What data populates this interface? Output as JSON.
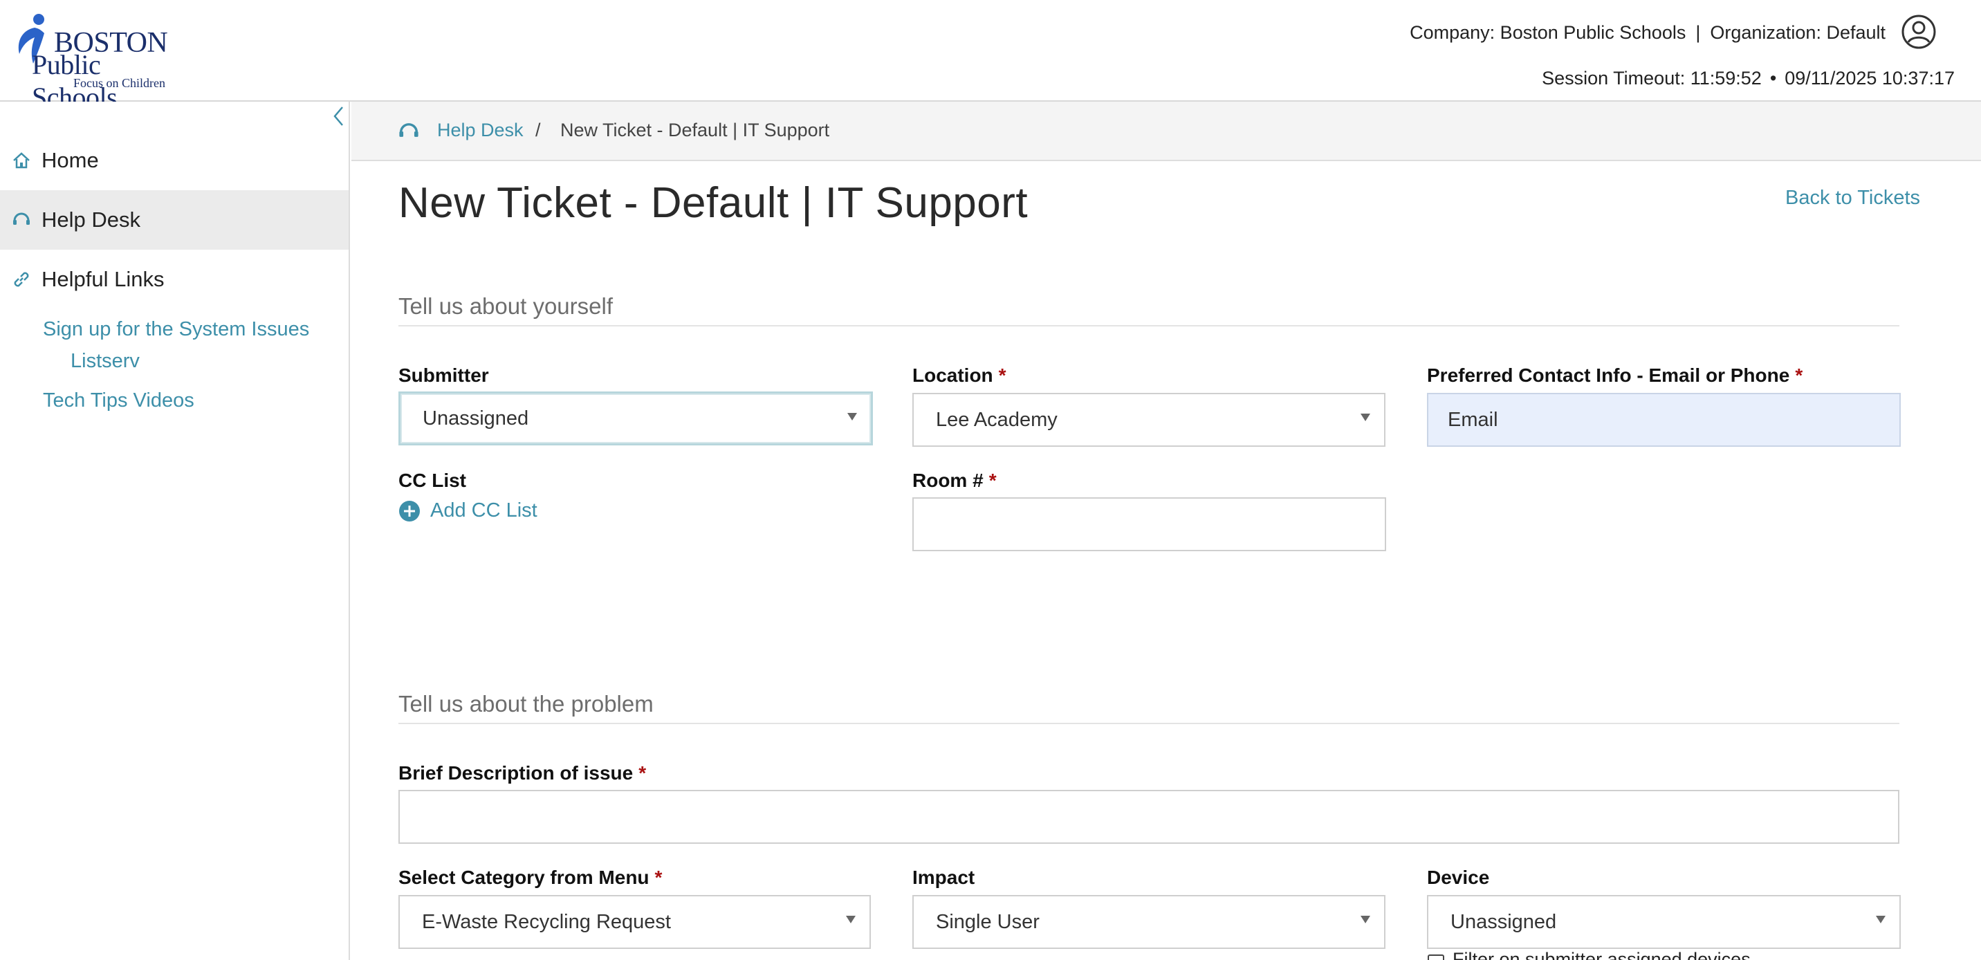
{
  "header": {
    "logo_line1": "BOSTON",
    "logo_line2": "Public Schools",
    "logo_tagline": "Focus on Children",
    "company": "Company: Boston Public Schools",
    "separator": "|",
    "organization": "Organization: Default",
    "session_timeout": "Session Timeout: 11:59:52",
    "bullet": "•",
    "datetime": "09/11/2025 10:37:17"
  },
  "sidebar": {
    "items": [
      {
        "label": "Home",
        "icon": "home-icon"
      },
      {
        "label": "Help Desk",
        "icon": "helpdesk-icon"
      },
      {
        "label": "Helpful Links",
        "icon": "link-icon"
      }
    ],
    "sub_links": [
      {
        "line1": "Sign up for the System Issues",
        "line2": "Listserv"
      },
      {
        "line1": "Tech Tips Videos"
      }
    ]
  },
  "breadcrumb": {
    "link": "Help Desk",
    "separator": "/",
    "current": "New Ticket - Default | IT Support"
  },
  "page": {
    "title": "New Ticket - Default | IT Support",
    "back_link": "Back to Tickets"
  },
  "section_yourself": {
    "title": "Tell us about yourself",
    "submitter_label": "Submitter",
    "submitter_value": "Unassigned",
    "location_label": "Location",
    "location_value": "Lee Academy",
    "contact_label": "Preferred Contact Info - Email or Phone",
    "contact_value": "Email",
    "cc_label": "CC List",
    "add_cc": "Add CC List",
    "room_label": "Room #",
    "room_value": ""
  },
  "section_problem": {
    "title": "Tell us about the problem",
    "brief_label": "Brief Description of issue",
    "brief_value": "",
    "category_label": "Select Category from Menu",
    "category_value": "E-Waste Recycling Request",
    "impact_label": "Impact",
    "impact_value": "Single User",
    "device_label": "Device",
    "device_value": "Unassigned",
    "filter_label": "Filter on submitter assigned devices"
  },
  "required_marker": "*",
  "colors": {
    "link": "#3d8fa9",
    "required": "#a11111",
    "active_nav_bg": "#ebebeb",
    "contact_field_bg": "#e8effc"
  }
}
